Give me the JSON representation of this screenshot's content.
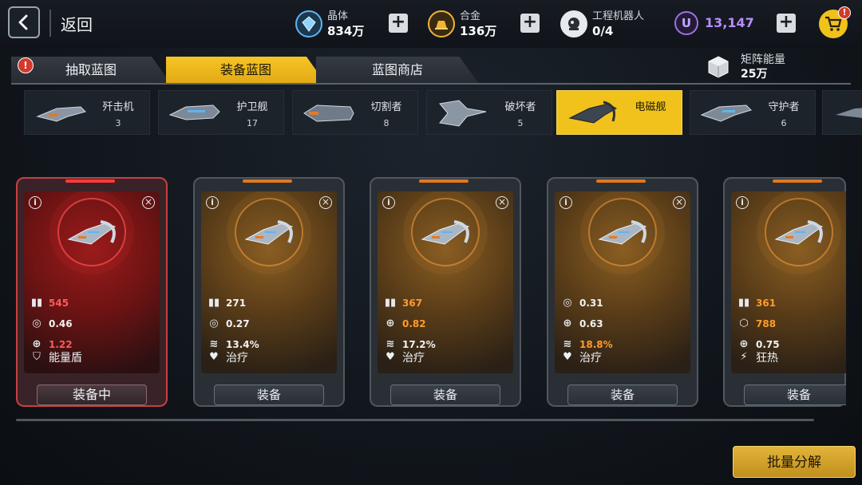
{
  "header": {
    "back_label": "返回",
    "resources": [
      {
        "label": "晶体",
        "value": "834万",
        "icon": "crystal-icon"
      },
      {
        "label": "合金",
        "value": "136万",
        "icon": "alloy-icon"
      },
      {
        "label": "工程机器人",
        "value": "0/4",
        "icon": "robot-icon"
      }
    ],
    "u_coin": {
      "symbol": "U",
      "value": "13,147"
    },
    "cart_badge": "!"
  },
  "tabs": {
    "items": [
      {
        "label": "抽取蓝图",
        "active": false,
        "alert": "!"
      },
      {
        "label": "装备蓝图",
        "active": true
      },
      {
        "label": "蓝图商店",
        "active": false
      }
    ]
  },
  "energy": {
    "label": "矩阵能量",
    "value": "25万"
  },
  "ship_classes": [
    {
      "name": "歼击机",
      "count": "3",
      "active": false
    },
    {
      "name": "护卫舰",
      "count": "17",
      "active": false
    },
    {
      "name": "切割者",
      "count": "8",
      "active": false
    },
    {
      "name": "破坏者",
      "count": "5",
      "active": false
    },
    {
      "name": "电磁舰",
      "count": "",
      "active": true
    },
    {
      "name": "守护者",
      "count": "6",
      "active": false
    }
  ],
  "cards": [
    {
      "equipped": true,
      "stats": [
        {
          "icon": "ammo-icon",
          "value": "545",
          "color": "red"
        },
        {
          "icon": "rate-icon",
          "value": "0.46",
          "color": "white"
        },
        {
          "icon": "crosshair-icon",
          "value": "1.22",
          "color": "red"
        }
      ],
      "skill": {
        "icon": "shield-icon",
        "label": "能量盾"
      },
      "button": "装备中"
    },
    {
      "equipped": false,
      "stats": [
        {
          "icon": "ammo-icon",
          "value": "271",
          "color": "white"
        },
        {
          "icon": "rate-icon",
          "value": "0.27",
          "color": "white"
        },
        {
          "icon": "speed-icon",
          "value": "13.4%",
          "color": "white"
        }
      ],
      "skill": {
        "icon": "heal-icon",
        "label": "治疗"
      },
      "button": "装备"
    },
    {
      "equipped": false,
      "stats": [
        {
          "icon": "ammo-icon",
          "value": "367",
          "color": "orange"
        },
        {
          "icon": "crosshair-icon",
          "value": "0.82",
          "color": "orange"
        },
        {
          "icon": "speed-icon",
          "value": "17.2%",
          "color": "white"
        }
      ],
      "skill": {
        "icon": "heal-icon",
        "label": "治疗"
      },
      "button": "装备"
    },
    {
      "equipped": false,
      "stats": [
        {
          "icon": "rate-icon",
          "value": "0.31",
          "color": "white"
        },
        {
          "icon": "crosshair-icon",
          "value": "0.63",
          "color": "white"
        },
        {
          "icon": "speed-icon",
          "value": "18.8%",
          "color": "orange"
        }
      ],
      "skill": {
        "icon": "heal-icon",
        "label": "治疗"
      },
      "button": "装备"
    },
    {
      "equipped": false,
      "stats": [
        {
          "icon": "ammo-icon",
          "value": "361",
          "color": "orange"
        },
        {
          "icon": "hex-icon",
          "value": "788",
          "color": "orange"
        },
        {
          "icon": "crosshair-icon",
          "value": "0.75",
          "color": "white"
        }
      ],
      "skill": {
        "icon": "frenzy-icon",
        "label": "狂热"
      },
      "button": "装备"
    }
  ],
  "footer": {
    "batch_button": "批量分解"
  },
  "colors": {
    "accent": "#f0c21b",
    "red_stat": "#ff5a5a",
    "orange_stat": "#ff9b2e",
    "u_coin": "#b98cff"
  }
}
